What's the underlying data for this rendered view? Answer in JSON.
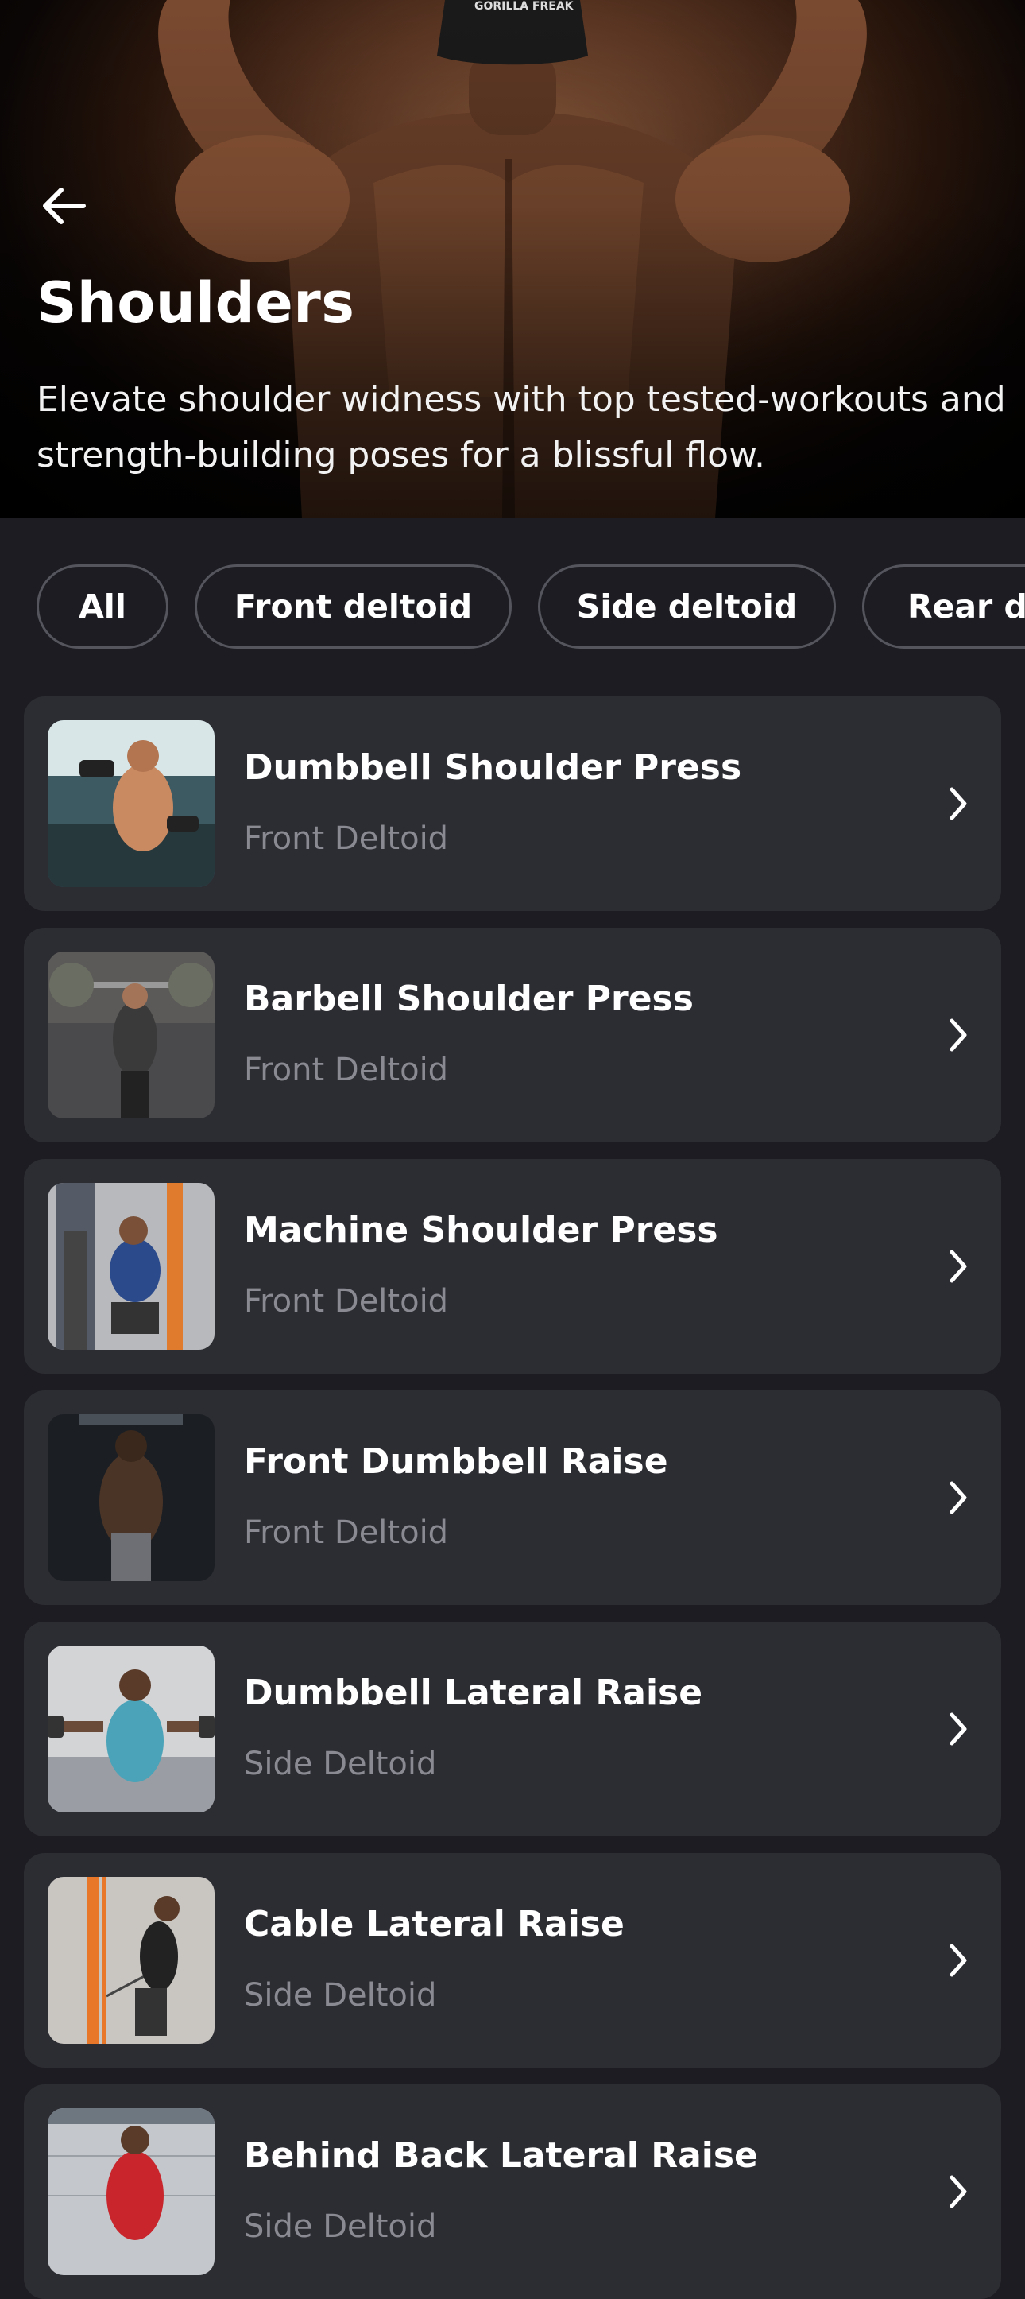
{
  "hero": {
    "title": "Shoulders",
    "subtitle": "Elevate shoulder widness with top tested-workouts and strength-building poses for a blissful flow.",
    "cap_text": "GORILLA FREAK",
    "back_icon": "arrow-left-icon"
  },
  "filters": [
    {
      "label": "All"
    },
    {
      "label": "Front deltoid"
    },
    {
      "label": "Side deltoid"
    },
    {
      "label": "Rear deltoid"
    }
  ],
  "exercises": [
    {
      "name": "Dumbbell Shoulder Press",
      "muscle": "Front Deltoid"
    },
    {
      "name": "Barbell Shoulder Press",
      "muscle": "Front Deltoid"
    },
    {
      "name": "Machine Shoulder Press",
      "muscle": "Front Deltoid"
    },
    {
      "name": "Front Dumbbell Raise",
      "muscle": "Front Deltoid"
    },
    {
      "name": "Dumbbell Lateral Raise",
      "muscle": "Side Deltoid"
    },
    {
      "name": "Cable Lateral Raise",
      "muscle": "Side Deltoid"
    },
    {
      "name": "Behind Back Lateral Raise",
      "muscle": "Side Deltoid"
    }
  ],
  "colors": {
    "background": "#1c1c22",
    "card": "#2c2c33",
    "chip_border": "#55555e",
    "secondary_text": "#8a8a92"
  }
}
